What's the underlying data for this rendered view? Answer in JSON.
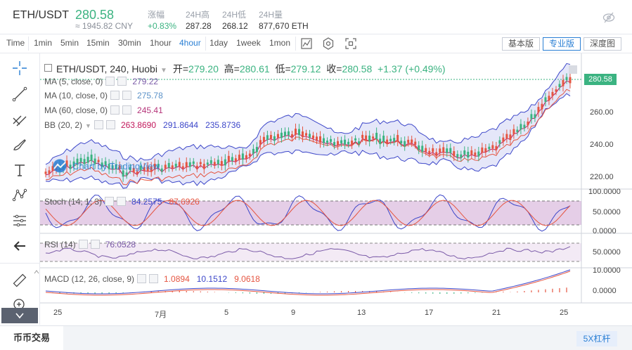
{
  "header": {
    "symbol": "ETH/USDT",
    "price": "280.58",
    "price_cny": "≈ 1945.82 CNY",
    "stats": [
      {
        "label": "涨幅",
        "value": "+0.83%"
      },
      {
        "label": "24H高",
        "value": "287.28"
      },
      {
        "label": "24H低",
        "value": "268.12"
      },
      {
        "label": "24H量",
        "value": "877,670 ETH"
      }
    ]
  },
  "toolbar": {
    "timeframes": [
      "Time",
      "1min",
      "5min",
      "15min",
      "30min",
      "1hour",
      "4hour",
      "1day",
      "1week",
      "1mon"
    ],
    "active_timeframe": "4hour",
    "views": [
      "基本版",
      "专业版",
      "深度图"
    ],
    "active_view": "专业版"
  },
  "ohlc": {
    "title": "ETH/USDT, 240, Huobi",
    "open_label": "开=",
    "open": "279.20",
    "high_label": "高=",
    "high": "280.61",
    "low_label": "低=",
    "low": "279.12",
    "close_label": "收=",
    "close": "280.58",
    "change": "+1.37 (+0.49%)"
  },
  "studies": {
    "ma5": {
      "label": "MA (5, close, 0)",
      "value": "279.22"
    },
    "ma10": {
      "label": "MA (10, close, 0)",
      "value": "275.78"
    },
    "ma60": {
      "label": "MA (60, close, 0)",
      "value": "245.41"
    },
    "bb": {
      "label": "BB (20, 2)",
      "v1": "263.8690",
      "v2": "291.8644",
      "v3": "235.8736"
    },
    "stoch": {
      "label": "Stoch (14, 1, 3)",
      "v1": "84.2575",
      "v2": "87.6926"
    },
    "rsi": {
      "label": "RSI (14)",
      "v1": "76.0528"
    },
    "macd": {
      "label": "MACD (12, 26, close, 9)",
      "v1": "1.0894",
      "v2": "10.1512",
      "v3": "9.0618"
    }
  },
  "watermark": "Chart by TradingView",
  "price_axis": {
    "last": "280.58",
    "ticks": [
      "260.00",
      "240.00",
      "220.00"
    ]
  },
  "stoch_axis": [
    "100.0000",
    "50.0000",
    "0.0000"
  ],
  "rsi_axis": [
    "50.0000"
  ],
  "macd_axis": [
    "10.0000",
    "0.0000"
  ],
  "time_axis": [
    "25",
    "7月",
    "5",
    "9",
    "13",
    "17",
    "21",
    "25"
  ],
  "footer": {
    "tab": "币币交易",
    "leverage": "5X杠杆"
  },
  "colors": {
    "up": "#3bb381",
    "down": "#e55541",
    "accent": "#2a7fd4",
    "ma5": "#7b5ba8",
    "ma10": "#5b92c8",
    "ma60": "#b5357a",
    "bb_mid": "#c2185b",
    "bb_band": "#3d47c9"
  }
}
